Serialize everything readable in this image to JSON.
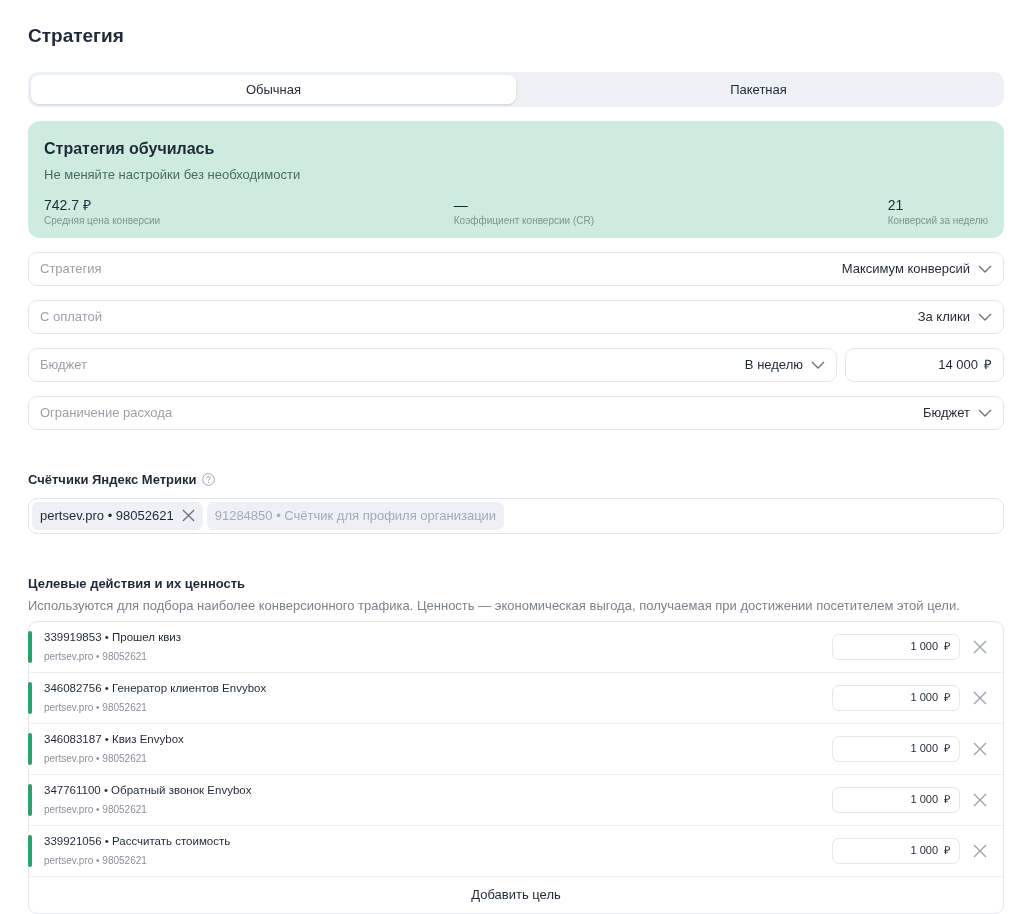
{
  "title": "Стратегия",
  "tabs": [
    {
      "label": "Обычная",
      "selected": true
    },
    {
      "label": "Пакетная",
      "selected": false
    }
  ],
  "status_card": {
    "title": "Стратегия обучилась",
    "subtitle": "Не меняйте настройки без необходимости",
    "stats": [
      {
        "value": "742.7 ₽",
        "label": "Средняя цена конверсии"
      },
      {
        "value": "—",
        "label": "Коэффициент конверсии (CR)"
      },
      {
        "value": "21",
        "label": "Конверсий за неделю"
      }
    ]
  },
  "settings": [
    {
      "kind": "select",
      "label": "Стратегия",
      "value": "Максимум конверсий"
    },
    {
      "kind": "select",
      "label": "С оплатой",
      "value": "За клики"
    },
    {
      "kind": "budget",
      "label": "Бюджет",
      "value": "В неделю",
      "amount": "14 000",
      "currency": "₽"
    },
    {
      "kind": "select",
      "label": "Ограничение расхода",
      "value": "Бюджет"
    }
  ],
  "counters": {
    "title": "Счётчики Яндекс Метрики",
    "chips": [
      {
        "label": "pertsev.pro • 98052621",
        "selected": true
      },
      {
        "label": "91284850 • Счётчик для профиля организации",
        "selected": false
      }
    ]
  },
  "goals": {
    "title": "Целевые действия и их ценность",
    "description": "Используются для подбора наиболее конверсионного трафика. Ценность — экономическая выгода, получаемая при достижении посетителем этой цели.",
    "items": [
      {
        "name": "339919853 • Прошел квиз",
        "counter": "pertsev.pro • 98052621",
        "value": "1 000",
        "currency": "₽"
      },
      {
        "name": "346082756 • Генератор клиентов Envybox",
        "counter": "pertsev.pro • 98052621",
        "value": "1 000",
        "currency": "₽"
      },
      {
        "name": "346083187 • Квиз Envybox",
        "counter": "pertsev.pro • 98052621",
        "value": "1 000",
        "currency": "₽"
      },
      {
        "name": "347761100 • Обратный звонок Envybox",
        "counter": "pertsev.pro • 98052621",
        "value": "1 000",
        "currency": "₽"
      },
      {
        "name": "339921056 • Рассчитать стоимость",
        "counter": "pertsev.pro • 98052621",
        "value": "1 000",
        "currency": "₽"
      }
    ],
    "add_button": "Добавить цель"
  }
}
